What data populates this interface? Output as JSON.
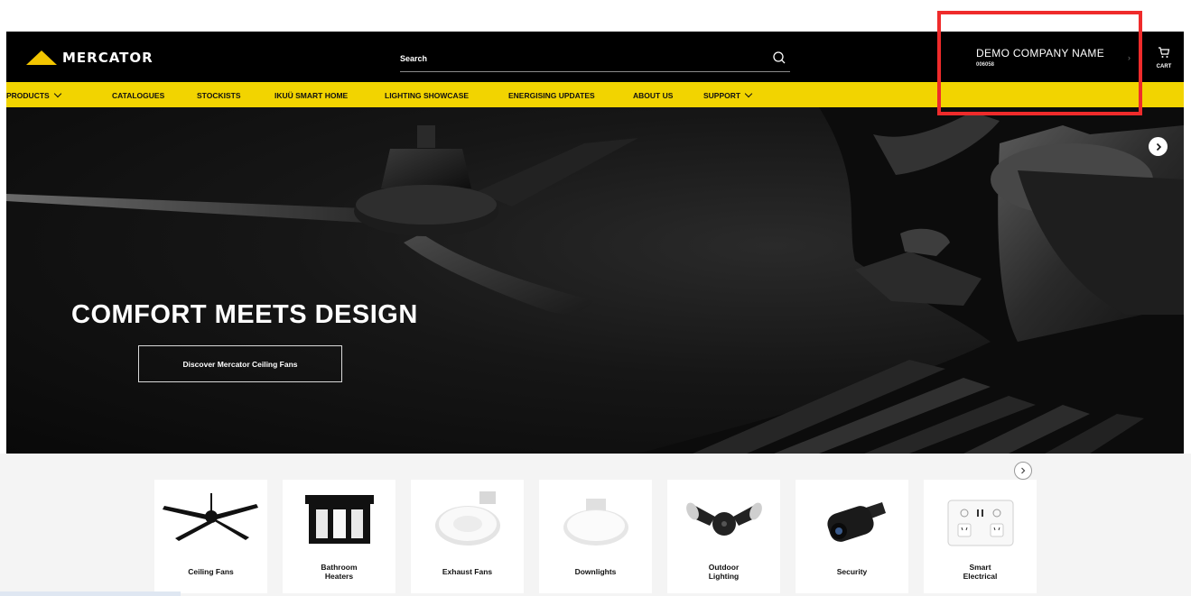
{
  "header": {
    "logo_text": "MERCATOR",
    "search_placeholder": "Search",
    "account_name": "DEMO COMPANY NAME",
    "account_id": "006058",
    "cart_label": "CART"
  },
  "nav": {
    "items": [
      {
        "label": "PRODUCTS",
        "dropdown": true
      },
      {
        "label": "CATALOGUES",
        "dropdown": false
      },
      {
        "label": "STOCKISTS",
        "dropdown": false
      },
      {
        "label": "IKUÜ SMART HOME",
        "dropdown": false
      },
      {
        "label": "LIGHTING SHOWCASE",
        "dropdown": false
      },
      {
        "label": "ENERGISING UPDATES",
        "dropdown": false
      },
      {
        "label": "ABOUT US",
        "dropdown": false
      },
      {
        "label": "SUPPORT",
        "dropdown": true
      }
    ]
  },
  "hero": {
    "title": "COMFORT MEETS DESIGN",
    "button_label": "Discover Mercator Ceiling Fans"
  },
  "categories": [
    {
      "label_lines": [
        "Ceiling Fans"
      ],
      "icon": "ceiling-fan-icon"
    },
    {
      "label_lines": [
        "Bathroom",
        "Heaters"
      ],
      "icon": "bathroom-heater-icon"
    },
    {
      "label_lines": [
        "Exhaust Fans"
      ],
      "icon": "exhaust-fan-icon"
    },
    {
      "label_lines": [
        "Downlights"
      ],
      "icon": "downlight-icon"
    },
    {
      "label_lines": [
        "Outdoor",
        "Lighting"
      ],
      "icon": "outdoor-light-icon"
    },
    {
      "label_lines": [
        "Security"
      ],
      "icon": "security-camera-icon"
    },
    {
      "label_lines": [
        "Smart",
        "Electrical"
      ],
      "icon": "smart-outlet-icon"
    }
  ],
  "colors": {
    "brand_yellow": "#f2d400",
    "header_bg": "#000000",
    "highlight_red": "#ef2b2b"
  }
}
